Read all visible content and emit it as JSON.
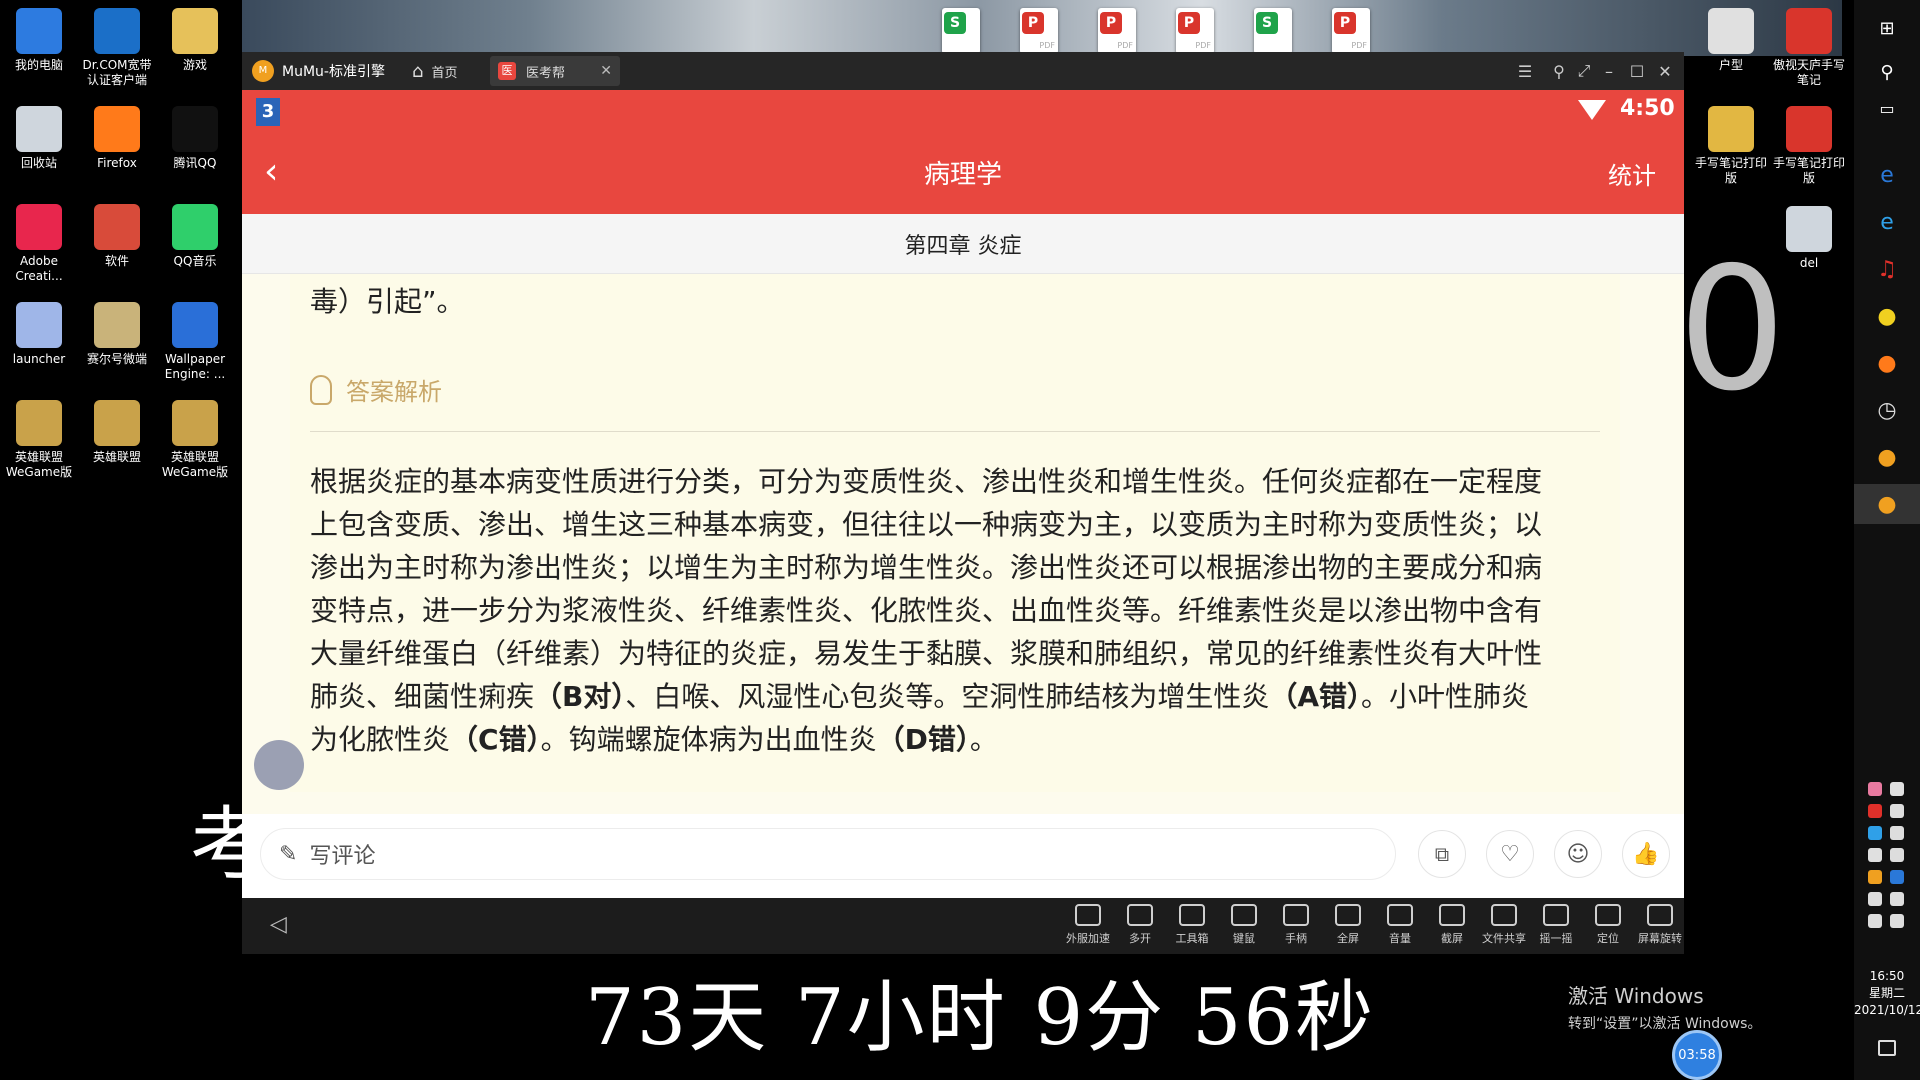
{
  "desktop": {
    "icons": [
      {
        "label": "我的电脑",
        "icon": "computer-icon",
        "color": "#2d7be0"
      },
      {
        "label": "Dr.COM宽带认证客户端",
        "icon": "network-globe-icon",
        "color": "#1b6fc8"
      },
      {
        "label": "游戏",
        "icon": "folder-icon",
        "color": "#e6c15a"
      },
      {
        "label": "回收站",
        "icon": "recycle-bin-icon",
        "color": "#cfd6dd"
      },
      {
        "label": "Firefox",
        "icon": "firefox-icon",
        "color": "#ff7a1a"
      },
      {
        "label": "腾讯QQ",
        "icon": "qq-penguin-icon",
        "color": "#111111"
      },
      {
        "label": "Adobe Creati...",
        "icon": "adobe-cc-icon",
        "color": "#e8264d"
      },
      {
        "label": "软件",
        "icon": "folder-icon",
        "color": "#d84b3a"
      },
      {
        "label": "QQ音乐",
        "icon": "qq-music-icon",
        "color": "#2fcf6b"
      },
      {
        "label": "launcher",
        "icon": "anime-launcher-icon",
        "color": "#9fb6e8"
      },
      {
        "label": "赛尔号微端",
        "icon": "seer-robot-icon",
        "color": "#c9b37a"
      },
      {
        "label": "Wallpaper Engine: ...",
        "icon": "wallpaper-engine-icon",
        "color": "#2a6fd8"
      },
      {
        "label": "英雄联盟WeGame版",
        "icon": "lol-icon",
        "color": "#c9a24a"
      },
      {
        "label": "英雄联盟",
        "icon": "lol-icon",
        "color": "#c9a24a"
      },
      {
        "label": "英雄联盟WeGame版",
        "icon": "lol-icon",
        "color": "#c9a24a"
      },
      {
        "label": "户型",
        "icon": "file-icon",
        "color": "#e0e0e0"
      },
      {
        "label": "傲视天庐手写笔记",
        "icon": "pdf-icon",
        "color": "#d9352c"
      },
      {
        "label": "手写笔记打印版",
        "icon": "zip-icon",
        "color": "#e2b742"
      },
      {
        "label": "手写笔记打印版",
        "icon": "pdf-icon",
        "color": "#d9352c"
      },
      {
        "label": "del",
        "icon": "gear-file-icon",
        "color": "#cfd6dd"
      }
    ],
    "top_files": [
      {
        "badge": "S",
        "type": "sheet-icon",
        "color": "#1fa34a"
      },
      {
        "badge": "P",
        "type": "pdf-icon",
        "color": "#d9352c"
      },
      {
        "badge": "P",
        "type": "pdf-icon",
        "color": "#d9352c"
      },
      {
        "badge": "P",
        "type": "pdf-icon",
        "color": "#d9352c"
      },
      {
        "badge": "S",
        "type": "sheet-icon",
        "color": "#1fa34a"
      },
      {
        "badge": "P",
        "type": "pdf-icon",
        "color": "#d9352c"
      }
    ],
    "top_file_tags": {
      "pdf": "PDF"
    },
    "overlay_big_char": "考",
    "overlay_big_zero": "0",
    "countdown": "73天  7小时  9分  56秒",
    "activate_title": "激活 Windows",
    "activate_subtitle": "转到“设置”以激活 Windows。",
    "timer_bubble": "03:58"
  },
  "taskbar": {
    "time": "16:50",
    "weekday": "星期二",
    "date": "2021/10/12"
  },
  "emulator": {
    "logo_text": "MuMu-标准引擎",
    "tabs": [
      {
        "label": "首页",
        "icon": "home-icon"
      },
      {
        "label": "医考帮",
        "icon": "app-badge-icon"
      }
    ],
    "tools": [
      {
        "label": "外服加速"
      },
      {
        "label": "多开"
      },
      {
        "label": "工具箱"
      },
      {
        "label": "键鼠"
      },
      {
        "label": "手柄"
      },
      {
        "label": "全屏"
      },
      {
        "label": "音量"
      },
      {
        "label": "截屏"
      },
      {
        "label": "文件共享"
      },
      {
        "label": "摇一摇"
      },
      {
        "label": "定位"
      },
      {
        "label": "屏幕旋转"
      }
    ]
  },
  "phone": {
    "status": {
      "badge": "3",
      "time": "4:50"
    },
    "appbar": {
      "title": "病理学",
      "action": "统计"
    },
    "chapter": "第四章 炎症",
    "question_tail": "毒）引起”。",
    "answer_section_label": "答案解析",
    "answer_lines": [
      "根据炎症的基本病变性质进行分类，可分为变质性炎、渗出性炎和增生性炎。任何炎症都在一定程度",
      "上包含变质、渗出、增生这三种基本病变，但往往以一种病变为主，以变质为主时称为变质性炎；以",
      "渗出为主时称为渗出性炎；以增生为主时称为增生性炎。渗出性炎还可以根据渗出物的主要成分和病",
      "变特点，进一步分为浆液性炎、纤维素性炎、化脓性炎、出血性炎等。纤维素性炎是以渗出物中含有",
      "大量纤维蛋白（纤维素）为特征的炎症，易发生于黏膜、浆膜和肺组织，常见的纤维素性炎有大叶性"
    ],
    "answer_line6": {
      "a": "肺炎、细菌性痢疾",
      "b": "（B对）",
      "c": "、白喉、风湿性心包炎等。空洞性肺结核为增生性炎",
      "d": "（A错）",
      "e": "。小叶性肺炎"
    },
    "answer_line7": {
      "a": "为化脓性炎",
      "b": "（C错）",
      "c": "。钩端螺旋体病为出血性炎",
      "d": "（D错）",
      "e": "。"
    },
    "comment_placeholder": "写评论",
    "accent": "#e8473f",
    "answer_accent": "#c9a86a"
  }
}
